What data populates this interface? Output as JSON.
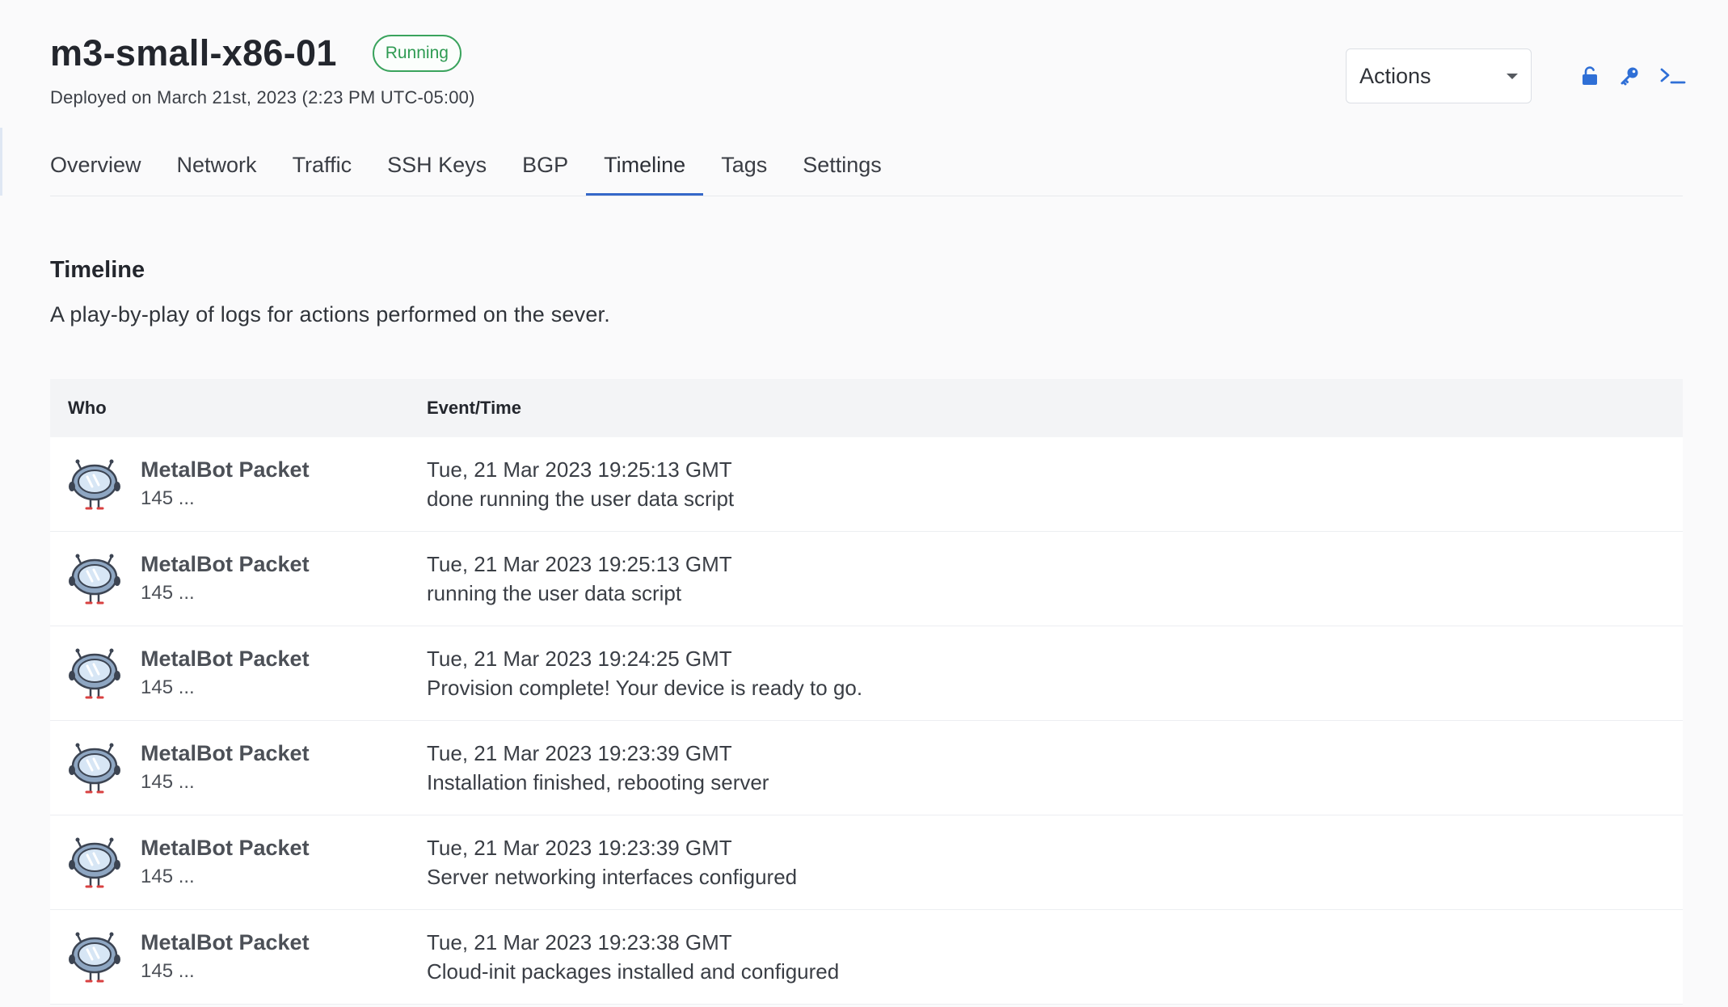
{
  "header": {
    "title": "m3-small-x86-01",
    "status": "Running",
    "deployed": "Deployed on March 21st, 2023 (2:23 PM UTC-05:00)",
    "actions_label": "Actions",
    "icons": [
      "unlock-icon",
      "key-icon",
      "terminal-icon"
    ],
    "accent_color": "#3568c9",
    "status_color": "#2f9b53"
  },
  "tabs": [
    {
      "label": "Overview",
      "active": false
    },
    {
      "label": "Network",
      "active": false
    },
    {
      "label": "Traffic",
      "active": false
    },
    {
      "label": "SSH Keys",
      "active": false
    },
    {
      "label": "BGP",
      "active": false
    },
    {
      "label": "Timeline",
      "active": true
    },
    {
      "label": "Tags",
      "active": false
    },
    {
      "label": "Settings",
      "active": false
    }
  ],
  "section": {
    "title": "Timeline",
    "description": "A play-by-play of logs for actions performed on the sever."
  },
  "table": {
    "columns": [
      "Who",
      "Event/Time"
    ],
    "rows": [
      {
        "who": "MetalBot Packet",
        "sub": "145 ...",
        "time": "Tue, 21 Mar 2023 19:25:13 GMT",
        "event": "done running the user data script"
      },
      {
        "who": "MetalBot Packet",
        "sub": "145 ...",
        "time": "Tue, 21 Mar 2023 19:25:13 GMT",
        "event": "running the user data script"
      },
      {
        "who": "MetalBot Packet",
        "sub": "145 ...",
        "time": "Tue, 21 Mar 2023 19:24:25 GMT",
        "event": "Provision complete! Your device is ready to go."
      },
      {
        "who": "MetalBot Packet",
        "sub": "145 ...",
        "time": "Tue, 21 Mar 2023 19:23:39 GMT",
        "event": "Installation finished, rebooting server"
      },
      {
        "who": "MetalBot Packet",
        "sub": "145 ...",
        "time": "Tue, 21 Mar 2023 19:23:39 GMT",
        "event": "Server networking interfaces configured"
      },
      {
        "who": "MetalBot Packet",
        "sub": "145 ...",
        "time": "Tue, 21 Mar 2023 19:23:38 GMT",
        "event": "Cloud-init packages installed and configured"
      }
    ]
  }
}
